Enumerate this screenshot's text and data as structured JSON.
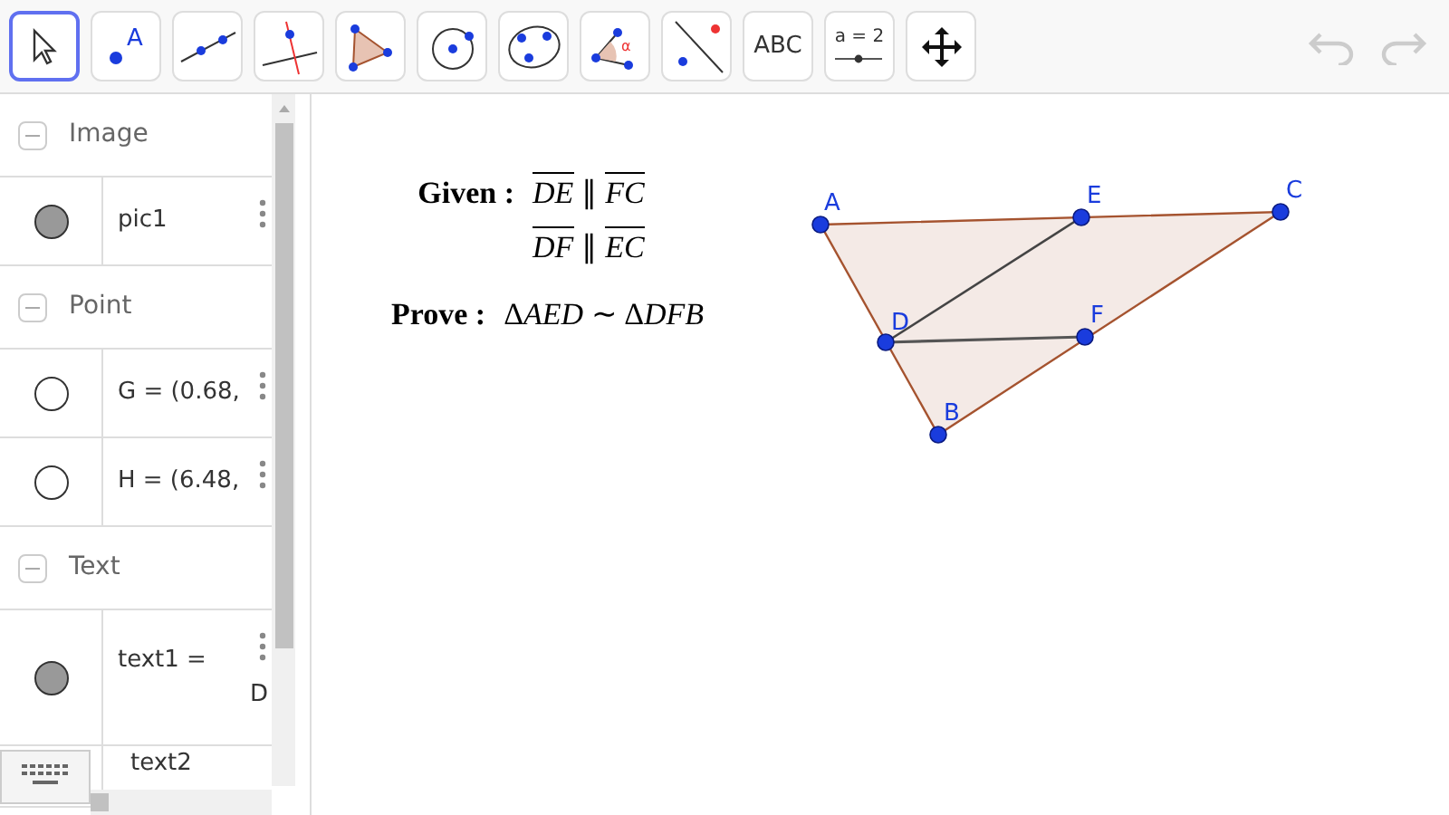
{
  "toolbar": {
    "tools": [
      {
        "kind": "move",
        "selected": true
      },
      {
        "kind": "point",
        "label": "A",
        "selected": false
      },
      {
        "kind": "line",
        "selected": false
      },
      {
        "kind": "perpendicular",
        "selected": false
      },
      {
        "kind": "polygon",
        "selected": false
      },
      {
        "kind": "circle",
        "selected": false
      },
      {
        "kind": "conic",
        "selected": false
      },
      {
        "kind": "angle",
        "label": "α",
        "selected": false
      },
      {
        "kind": "reflect",
        "selected": false
      },
      {
        "kind": "text",
        "label": "ABC",
        "selected": false
      },
      {
        "kind": "slider",
        "label": "a = 2",
        "selected": false
      },
      {
        "kind": "pan",
        "selected": false
      }
    ],
    "undo": {
      "disabled": true
    },
    "redo": {
      "disabled": true
    }
  },
  "algebra": {
    "groups": [
      {
        "title": "Image",
        "expanded": true,
        "items": [
          {
            "visible": true,
            "lines": [
              "pic1"
            ]
          }
        ]
      },
      {
        "title": "Point",
        "expanded": true,
        "items": [
          {
            "visible": false,
            "lines": [
              "G = (0.68,"
            ]
          },
          {
            "visible": false,
            "lines": [
              "H = (6.48,"
            ]
          }
        ]
      },
      {
        "title": "Text",
        "expanded": true,
        "items": [
          {
            "visible": true,
            "lines": [
              "text1 =",
              "D"
            ]
          },
          {
            "lines": [
              "text2"
            ]
          }
        ]
      }
    ]
  },
  "canvas": {
    "given_label": "Given :",
    "given": [
      [
        "DE",
        "∥",
        "FC"
      ],
      [
        "DF",
        "∥",
        "EC"
      ]
    ],
    "prove_label": "Prove :",
    "prove": [
      {
        "text": "Δ",
        "italic": false
      },
      {
        "text": "AED",
        "italic": true
      },
      {
        "text": " ∼ ",
        "italic": false
      },
      {
        "text": "Δ",
        "italic": false
      },
      {
        "text": "DFB",
        "italic": true
      }
    ],
    "points": [
      {
        "label": "A"
      },
      {
        "label": "E"
      },
      {
        "label": "C"
      },
      {
        "label": "D"
      },
      {
        "label": "F"
      },
      {
        "label": "B"
      }
    ]
  }
}
